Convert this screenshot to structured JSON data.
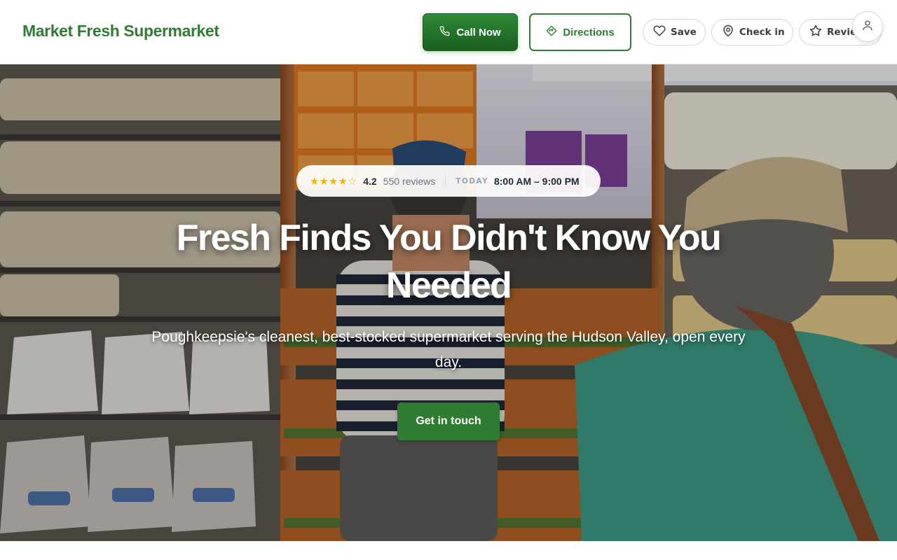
{
  "brand": {
    "name": "Market Fresh Supermarket"
  },
  "header": {
    "call_label": "Call Now",
    "directions_label": "Directions",
    "save_label": "Save",
    "checkin_label": "Check in",
    "review_label": "Review",
    "icons": [
      "phone-icon",
      "directions-icon",
      "heart-icon",
      "map-pin-icon",
      "star-icon",
      "user-icon"
    ]
  },
  "hero": {
    "stars_glyph": "★★★★☆",
    "rating": "4.2",
    "reviews": "550 reviews",
    "today_label": "TODAY",
    "hours": "8:00 AM – 9:00 PM",
    "headline": "Fresh Finds You Didn't Know You Needed",
    "subhead": "Poughkeepsie's cleanest, best-stocked supermarket serving the Hudson Valley, open every day.",
    "cta_label": "Get in touch"
  },
  "colors": {
    "brand_green": "#2e7d32",
    "dark_green": "#1b5e20",
    "star_gold": "#f4b400"
  }
}
